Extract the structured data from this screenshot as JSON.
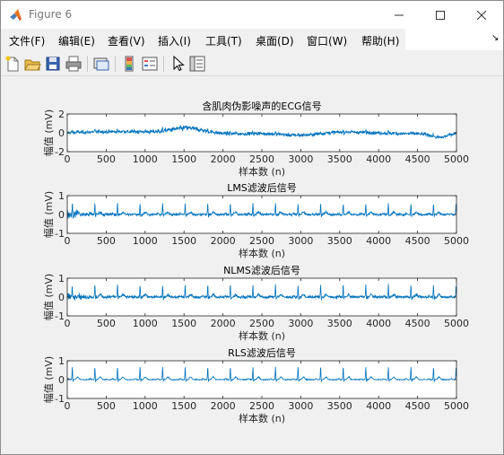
{
  "window": {
    "title": "Figure 6",
    "controls": {
      "minimize": "—",
      "maximize": "☐",
      "close": "✕"
    }
  },
  "menu": {
    "items": [
      "文件(F)",
      "编辑(E)",
      "查看(V)",
      "插入(I)",
      "工具(T)",
      "桌面(D)",
      "窗口(W)",
      "帮助(H)"
    ],
    "overflow_arrow": "↘"
  },
  "toolbar": {
    "icons": [
      "new-figure-icon",
      "open-file-icon",
      "save-icon",
      "print-icon",
      "link-plot-icon",
      "insert-colorbar-icon",
      "insert-legend-icon",
      "pointer-icon",
      "property-inspector-icon"
    ]
  },
  "colors": {
    "line": "#0072bd",
    "axes": "#262626",
    "background": "#f0f0f0",
    "plot_bg": "#ffffff"
  },
  "chart_data": [
    {
      "type": "line",
      "title": "含肌肉伪影噪声的ECG信号",
      "xlabel": "样本数 (n)",
      "ylabel": "幅值 (mV)",
      "xlim": [
        0,
        5000
      ],
      "ylim": [
        -2,
        2
      ],
      "xticks": [
        0,
        500,
        1000,
        1500,
        2000,
        2500,
        3000,
        3500,
        4000,
        4500,
        5000
      ],
      "yticks": [
        -2,
        0,
        2
      ],
      "signal": "noisy ECG with baseline wander"
    },
    {
      "type": "line",
      "title": "LMS滤波后信号",
      "xlabel": "样本数 (n)",
      "ylabel": "幅值 (mV)",
      "xlim": [
        0,
        5000
      ],
      "ylim": [
        -1,
        1
      ],
      "xticks": [
        0,
        500,
        1000,
        1500,
        2000,
        2500,
        3000,
        3500,
        4000,
        4500,
        5000
      ],
      "yticks": [
        -1,
        0,
        1
      ],
      "signal": "LMS filtered ECG"
    },
    {
      "type": "line",
      "title": "NLMS滤波后信号",
      "xlabel": "样本数 (n)",
      "ylabel": "幅值 (mV)",
      "xlim": [
        0,
        5000
      ],
      "ylim": [
        -1,
        1
      ],
      "xticks": [
        0,
        500,
        1000,
        1500,
        2000,
        2500,
        3000,
        3500,
        4000,
        4500,
        5000
      ],
      "yticks": [
        -1,
        0,
        1
      ],
      "signal": "NLMS filtered ECG"
    },
    {
      "type": "line",
      "title": "RLS滤波后信号",
      "xlabel": "样本数 (n)",
      "ylabel": "幅值 (mV)",
      "xlim": [
        0,
        5000
      ],
      "ylim": [
        -1,
        1
      ],
      "xticks": [
        0,
        500,
        1000,
        1500,
        2000,
        2500,
        3000,
        3500,
        4000,
        4500,
        5000
      ],
      "yticks": [
        -1,
        0,
        1
      ],
      "signal": "RLS filtered ECG"
    }
  ]
}
